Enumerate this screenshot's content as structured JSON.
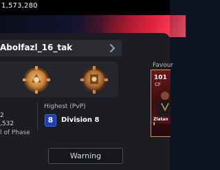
{
  "top_bar": {
    "coins": "1,573,280"
  },
  "profile": {
    "username": "Abolfazl_16_tak"
  },
  "stats": {
    "value_1": "2",
    "value_2": ",532",
    "phase_label": "l of Phase"
  },
  "highest_pvp": {
    "label": "Highest (PvP)",
    "division_number": "8",
    "division_label": "Division 8"
  },
  "favourite": {
    "label": "Favour",
    "card": {
      "rating": "101",
      "position": "CF",
      "name": "Zlatan I"
    }
  },
  "warning_button": {
    "label": "Warning"
  },
  "colors": {
    "accent_red": "#e2243a",
    "division_blue": "#1a3fb8",
    "gold": "#c8a04a"
  }
}
